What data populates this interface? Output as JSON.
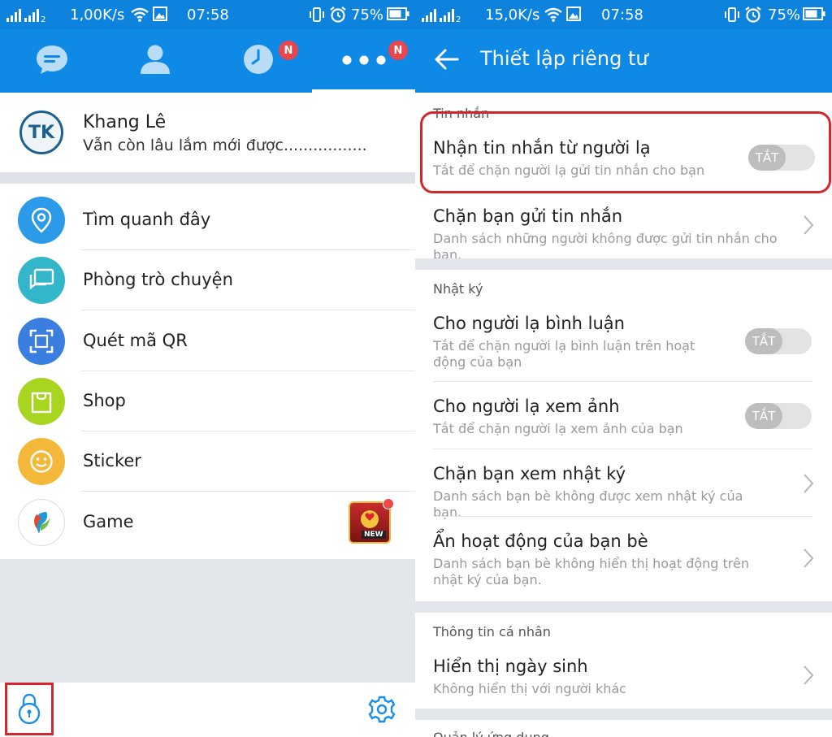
{
  "left": {
    "status": {
      "speed": "1,00K/s",
      "time": "07:58",
      "battery": "75%"
    },
    "tabs": [
      {
        "icon": "chat-icon"
      },
      {
        "icon": "contacts-icon"
      },
      {
        "icon": "clock-icon",
        "badge": "N"
      },
      {
        "icon": "more-dots-icon",
        "badge": "N",
        "active": true
      }
    ],
    "profile": {
      "avatar_text": "TK",
      "name": "Khang Lê",
      "status": "Vẫn còn lâu lắm mới được................."
    },
    "menu": [
      {
        "label": "Tìm quanh đây",
        "icon": "location-pin-icon",
        "color": "#2b9ae8"
      },
      {
        "label": "Phòng trò chuyện",
        "icon": "chat-rooms-icon",
        "color": "#33b6c9"
      },
      {
        "label": "Quét mã QR",
        "icon": "qr-scan-icon",
        "color": "#3a7fe0"
      },
      {
        "label": "Shop",
        "icon": "shopping-bag-icon",
        "color": "#a7d520"
      },
      {
        "label": "Sticker",
        "icon": "smiley-icon",
        "color": "#f4b93a"
      },
      {
        "label": "Game",
        "icon": "game-logo-icon",
        "color": "#ffffff"
      }
    ],
    "game_thumb_text": "NEW"
  },
  "right": {
    "status": {
      "speed": "15,0K/s",
      "time": "07:58",
      "battery": "75%"
    },
    "title": "Thiết lập riêng tư",
    "sections": {
      "messages": "Tin nhắn",
      "diary": "Nhật ký",
      "personal": "Thông tin cá nhân",
      "app": "Quản lý ứng dụng"
    },
    "toggle_off_label": "TẮT",
    "rows": {
      "stranger_msg": {
        "title": "Nhận tin nhắn từ người lạ",
        "sub": "Tắt để chặn người lạ gửi tin nhắn cho bạn"
      },
      "block_msg": {
        "title": "Chặn bạn gửi tin nhắn",
        "sub": "Danh sách những người không được gửi tin nhắn cho bạn."
      },
      "stranger_comment": {
        "title": "Cho người lạ bình luận",
        "sub": "Tắt để chặn người lạ bình luận trên hoạt động của bạn"
      },
      "stranger_photo": {
        "title": "Cho người lạ xem ảnh",
        "sub": "Tắt để chặn người lạ xem ảnh của bạn"
      },
      "block_diary": {
        "title": "Chặn bạn xem nhật ký",
        "sub": "Danh sách bạn bè không được xem nhật ký của bạn."
      },
      "hide_activity": {
        "title": "Ẩn hoạt động của bạn bè",
        "sub": "Danh sách bạn bè không hiển thị hoạt động trên nhật ký của bạn."
      },
      "birthday": {
        "title": "Hiển thị ngày sinh",
        "sub": "Không hiển thị với người khác"
      }
    }
  },
  "colors": {
    "header_blue": "#0e8ae6",
    "highlight_red": "#d3262d",
    "badge_red": "#e8474d"
  }
}
